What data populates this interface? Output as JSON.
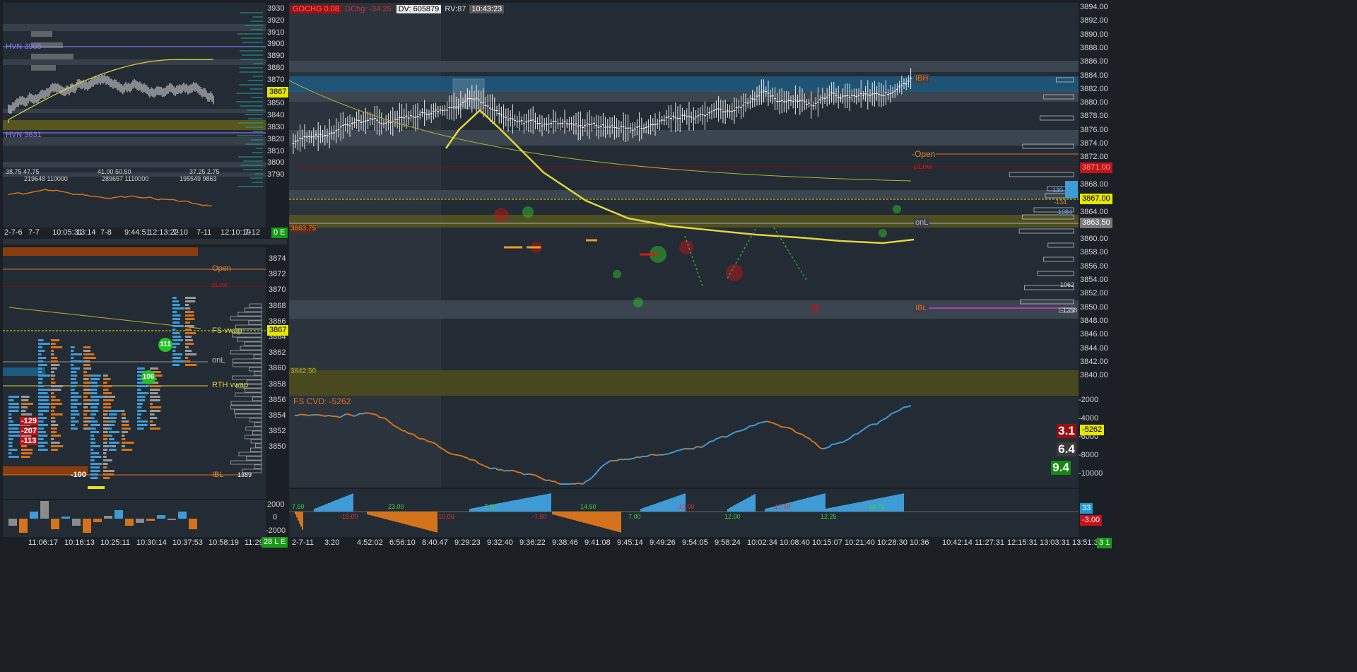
{
  "overview": {
    "hvn_top": "HVN  3905",
    "hvn_bottom": "HVN  3831",
    "price_ticks": [
      "3930",
      "3920",
      "3910",
      "3900",
      "3890",
      "3880",
      "3870",
      "3860",
      "3850",
      "3840",
      "3830",
      "3820",
      "3810",
      "3800",
      "3790"
    ],
    "price_tag": "3867",
    "stats": [
      [
        "38.75",
        "47.75"
      ],
      [
        "41.00",
        "50.50"
      ],
      [
        "37.25",
        "2.75"
      ]
    ],
    "stats2": [
      "219648",
      "110000",
      "289657",
      "1110000",
      "195549",
      "9863"
    ],
    "x_ticks": [
      "2-7-6",
      "7-7",
      "10:05:31",
      "13:14",
      "7-8",
      "9:44:51",
      "12:13:22",
      "7-10",
      "7-11",
      "12:10:19",
      "7-12"
    ],
    "status": "0 E"
  },
  "footprint": {
    "price_ticks": [
      "3874",
      "3872",
      "3870",
      "3868",
      "3866",
      "3864",
      "3862",
      "3860",
      "3858",
      "3856",
      "3854",
      "3852",
      "3850"
    ],
    "price_tag": "3867",
    "labels": {
      "open": "Open",
      "plow": "pLow",
      "fsvwap": "FS vwap",
      "onl": "onL",
      "rth": "RTH vwap",
      "ibl": "IBL",
      "ibl_val": "1389"
    },
    "deltas": [
      "-129",
      "-207",
      "-113",
      "-100"
    ],
    "bubbles": [
      "111",
      "106"
    ],
    "x_ticks": [
      "11:06:17",
      "10:16:13",
      "10:25:11",
      "10:30:14",
      "10:37:53",
      "10:58:19",
      "11:29:17"
    ],
    "status": "28 L E",
    "bar_axis": [
      "2000",
      "0",
      "-2000"
    ]
  },
  "main": {
    "header": {
      "a": "GOCHG 0.08",
      "b": "DChg: -34.25",
      "dv": "DV: 605879",
      "rv": "RV:87",
      "time": "10:43:23"
    },
    "price_ticks": [
      "3894.00",
      "3892.00",
      "3890.00",
      "3888.00",
      "3886.00",
      "3884.00",
      "3882.00",
      "3880.00",
      "3878.00",
      "3876.00",
      "3874.00",
      "3872.00",
      "3870.00",
      "3868.00",
      "3866.00",
      "3864.00",
      "3862.00",
      "3860.00",
      "3858.00",
      "3856.00",
      "3854.00",
      "3852.00",
      "3850.00",
      "3848.00",
      "3846.00",
      "3844.00",
      "3842.00",
      "3840.00"
    ],
    "last_price": "3867.00",
    "plow_price": "3871.00",
    "onl_price": "3863.50",
    "left_tag_top": "3863.75",
    "left_tag_bottom": "3842.50",
    "levels": {
      "ibh": "IBH",
      "open": "-Open",
      "plow": "pLow",
      "onl": "onL",
      "ibl": "IBL"
    },
    "profile_labels": [
      "130",
      "-134",
      "1084",
      "1062",
      "-1358"
    ],
    "cvd_title": "FS CVD: -5262",
    "cvd_ticks": [
      "-2000",
      "-4000",
      "-6000",
      "-8000",
      "-10000"
    ],
    "cvd_tag": "-5262",
    "ratios": [
      "3.1",
      "6.4",
      "9.4"
    ],
    "delta_labels": [
      "7.50",
      "-15.00",
      "23.00",
      "-10.00",
      "7.00",
      "-7.50",
      "14.50",
      "7.00",
      "-12.00",
      "12.00",
      "-17.50",
      "12.25",
      "18.75"
    ],
    "delta_axis": [
      "33",
      "-3.00"
    ],
    "x_ticks": [
      "2-7-11",
      "3:20",
      "4:52:02",
      "6:56:10",
      "8:40:47",
      "9:29:23",
      "9:32:40",
      "9:36:22",
      "9:38:46",
      "9:41:08",
      "9:45:14",
      "9:49:26",
      "9:54:05",
      "9:58:24",
      "10:02:34",
      "10:08:40",
      "10:15:07",
      "10:21:40",
      "10:28:30",
      "10:36",
      "10:42:14",
      "11:27:31",
      "12:15:31",
      "13:03:31",
      "13:51:31"
    ],
    "status": "3 1"
  },
  "colors": {
    "up": "#3f9bd6",
    "down": "#d4731c",
    "vwap": "#e0d63a",
    "pink": "#d63cd6",
    "green": "#2ec02e",
    "red": "#c0141a"
  }
}
